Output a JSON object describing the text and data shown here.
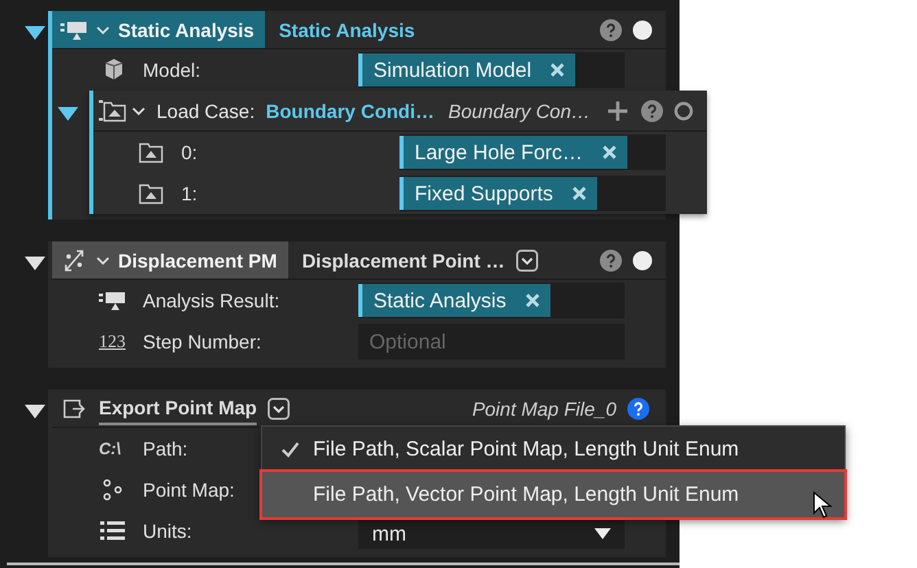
{
  "nodes": [
    {
      "kind": "analysis",
      "title": "Static Analysis",
      "subtitle": "Static Analysis",
      "selected": true,
      "expanded": true,
      "help_active": false,
      "rows": [
        {
          "kind": "model",
          "label": "Model:",
          "value": "Simulation Model"
        }
      ],
      "children": [
        {
          "kind": "loadcase",
          "title": "Load Case:",
          "value": "Boundary Condi…",
          "subtitle": "Boundary Con…",
          "expanded": true,
          "rows": [
            {
              "kind": "case",
              "label": "0:",
              "value": "Large Hole Forc…"
            },
            {
              "kind": "case",
              "label": "1:",
              "value": "Fixed Supports"
            }
          ]
        }
      ]
    },
    {
      "kind": "pointmap",
      "title": "Displacement PM",
      "subtitle": "Displacement Point …",
      "selected": false,
      "expanded": true,
      "help_active": false,
      "rows": [
        {
          "kind": "result",
          "label": "Analysis Result:",
          "value": "Static Analysis"
        },
        {
          "kind": "number",
          "icon_text": "123",
          "label": "Step Number:",
          "placeholder": "Optional"
        }
      ]
    },
    {
      "kind": "export",
      "title": "Export Point Map",
      "subtitle": "Point Map File_0",
      "expanded": true,
      "help_active": true,
      "rows": [
        {
          "kind": "path",
          "icon_text": "C:\\",
          "label": "Path:"
        },
        {
          "kind": "points",
          "label": "Point Map:"
        },
        {
          "kind": "units",
          "label": "Units:",
          "value": "mm"
        }
      ]
    }
  ],
  "menu": {
    "items": [
      {
        "label": "File Path, Scalar Point Map, Length Unit Enum",
        "checked": true,
        "selected": false
      },
      {
        "label": "File Path, Vector Point Map, Length Unit Enum",
        "checked": false,
        "selected": true
      }
    ]
  }
}
